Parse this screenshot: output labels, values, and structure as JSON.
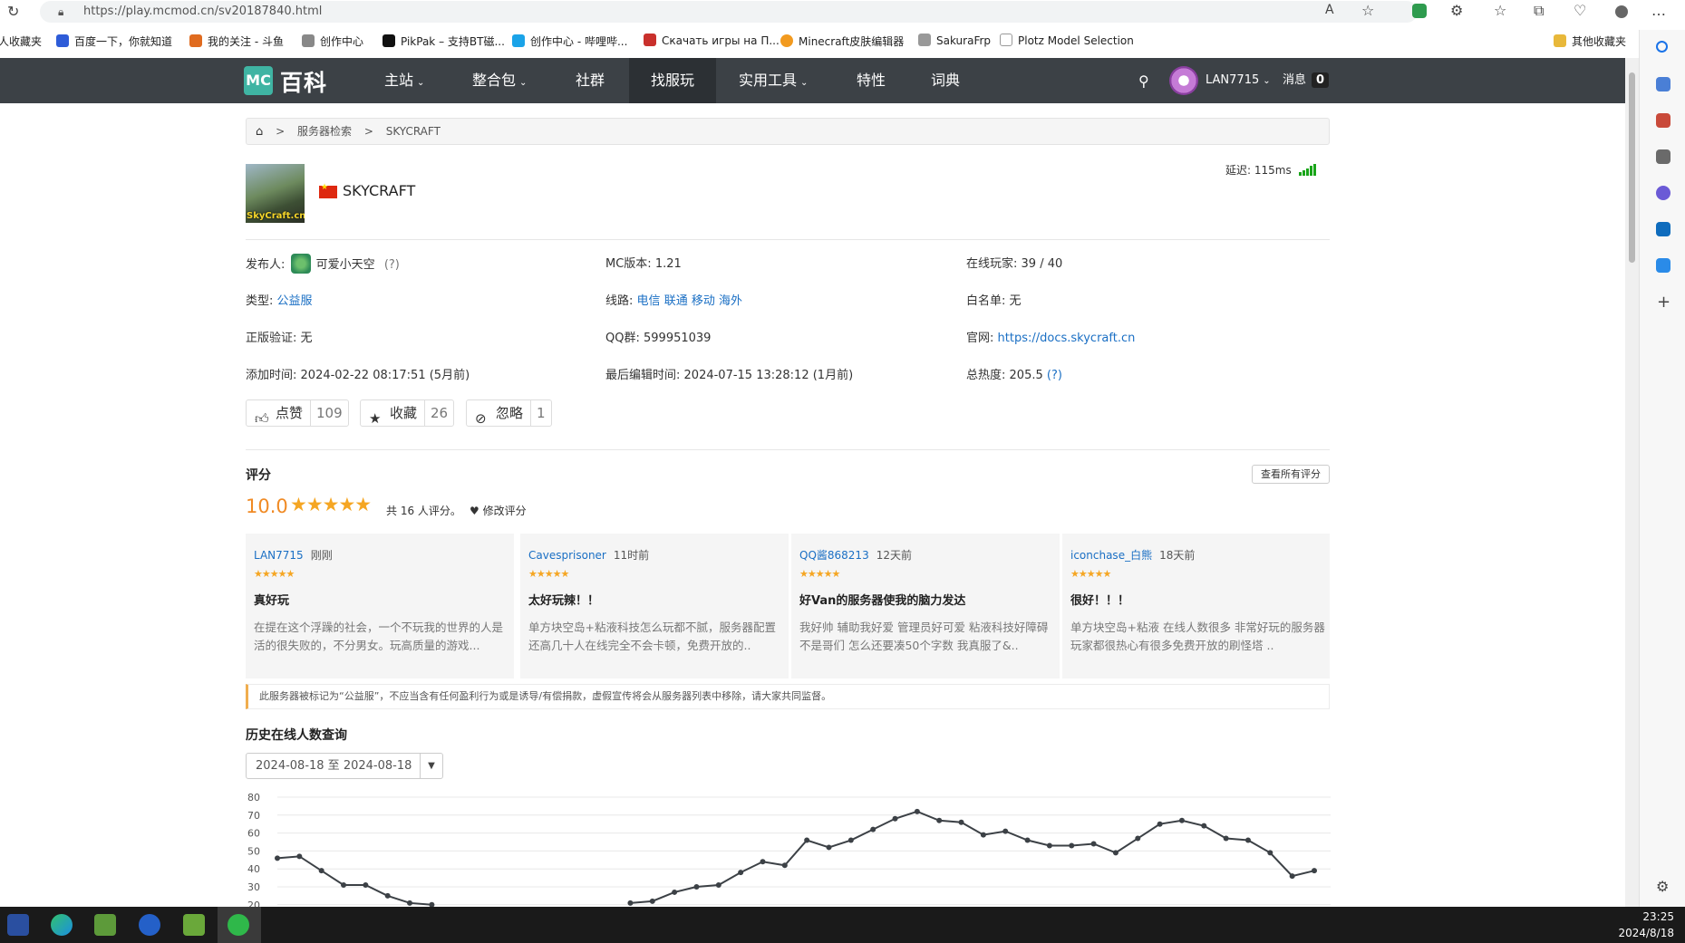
{
  "browser": {
    "url": "https://play.mcmod.cn/sv20187840.html",
    "bookmarks": [
      {
        "label": "人收藏夹",
        "icon": "folder-icon"
      },
      {
        "label": "百度一下，你就知道",
        "icon": "baidu-icon"
      },
      {
        "label": "我的关注 - 斗鱼",
        "icon": "douyu-icon"
      },
      {
        "label": "创作中心",
        "icon": "creator-icon"
      },
      {
        "label": "PikPak – 支持BT磁...",
        "icon": "pikpak-icon"
      },
      {
        "label": "创作中心 - 哔哩哔...",
        "icon": "bilibili-icon"
      },
      {
        "label": "Скачать игры на П...",
        "icon": "game-icon"
      },
      {
        "label": "Minecraft皮肤编辑器",
        "icon": "skin-editor-icon"
      },
      {
        "label": "SakuraFrp",
        "icon": "sakura-icon"
      },
      {
        "label": "Plotz Model Selection",
        "icon": "plotz-icon"
      },
      {
        "label": "其他收藏夹",
        "icon": "folder-icon"
      }
    ]
  },
  "nav": {
    "logo_mc": "MC",
    "logo_text": "百科",
    "items": [
      {
        "label": "主站",
        "dropdown": true
      },
      {
        "label": "整合包",
        "dropdown": true
      },
      {
        "label": "社群",
        "dropdown": false
      },
      {
        "label": "找服玩",
        "dropdown": false,
        "active": true
      },
      {
        "label": "实用工具",
        "dropdown": true
      },
      {
        "label": "特性",
        "dropdown": false
      },
      {
        "label": "词典",
        "dropdown": false
      }
    ],
    "user": "LAN7715",
    "msg_label": "消息",
    "msg_count": "0"
  },
  "breadcrumb": [
    "服务器检索",
    "SKYCRAFT"
  ],
  "server": {
    "thumb_label": "SkyCraft.cn",
    "name": "SKYCRAFT",
    "latency": "延迟: 115ms",
    "info": {
      "publisher_label": "发布人:",
      "publisher": "可爱小天空",
      "publisher_q": "(?)",
      "mc_version_label": "MC版本:",
      "mc_version": "1.21",
      "online_label": "在线玩家:",
      "online": "39 / 40",
      "type_label": "类型:",
      "type": "公益服",
      "line_label": "线路:",
      "lines": [
        "电信",
        "联通",
        "移动",
        "海外"
      ],
      "whitelist_label": "白名单:",
      "whitelist": "无",
      "genuine_label": "正版验证:",
      "genuine": "无",
      "qq_label": "QQ群:",
      "qq": "599951039",
      "site_label": "官网:",
      "site": "https://docs.skycraft.cn",
      "added_label": "添加时间:",
      "added": "2024-02-22 08:17:51 (5月前)",
      "edited_label": "最后编辑时间:",
      "edited": "2024-07-15 13:28:12 (1月前)",
      "heat_label": "总热度:",
      "heat": "205.5",
      "heat_q": "(?)"
    },
    "actions": [
      {
        "label": "点赞",
        "count": "109",
        "icon": "thumbs-up-icon"
      },
      {
        "label": "收藏",
        "count": "26",
        "icon": "star-icon"
      },
      {
        "label": "忽略",
        "count": "1",
        "icon": "eye-slash-icon"
      }
    ]
  },
  "rating": {
    "title": "评分",
    "view_all": "查看所有评分",
    "score": "10.0",
    "stars": 5,
    "count_text": "共 16 人评分。",
    "edit_label": "修改评分",
    "reviews": [
      {
        "user": "LAN7715",
        "time": "刚刚",
        "stars": 5,
        "title": "真好玩",
        "body": "在提在这个浮躁的社会，一个不玩我的世界的人是活的很失败的，不分男女。玩高质量的游戏..."
      },
      {
        "user": "Cavesprisoner",
        "time": "11时前",
        "stars": 5,
        "title": "太好玩辣！！",
        "body": "单方块空岛+粘液科技怎么玩都不腻，服务器配置还高几十人在线完全不会卡顿，免费开放的.."
      },
      {
        "user": "QQ酱868213",
        "time": "12天前",
        "stars": 5,
        "title": "好Van的服务器使我的脑力发达",
        "body": "我好帅 辅助我好爱 管理员好可爱 粘液科技好障碍不是哥们 怎么还要凑50个字数 我真服了&.."
      },
      {
        "user": "iconchase_白熊",
        "time": "18天前",
        "stars": 5,
        "title": "很好！！！",
        "body": "单方块空岛+粘液 在线人数很多 非常好玩的服务器 玩家都很热心有很多免费开放的刷怪塔 .."
      }
    ]
  },
  "notice": "此服务器被标记为“公益服”，不应当含有任何盈利行为或是诱导/有偿捐款，虚假宣传将会从服务器列表中移除，请大家共同监督。",
  "history": {
    "title": "历史在线人数查询",
    "date_range": "2024-08-18 至 2024-08-18"
  },
  "chart_data": {
    "type": "line",
    "title": "",
    "xlabel": "",
    "ylabel": "",
    "ylim": [
      0,
      80
    ],
    "yticks": [
      80,
      70,
      60,
      50,
      40,
      30,
      20
    ],
    "series": [
      {
        "values": [
          46,
          47,
          39,
          31,
          31,
          25,
          21,
          20,
          null,
          null,
          null,
          null,
          null,
          null,
          null,
          null,
          21,
          22,
          27,
          30,
          31,
          38,
          44,
          42,
          56,
          52,
          56,
          62,
          68,
          72,
          67,
          66,
          59,
          61,
          56,
          53,
          53,
          54,
          49,
          57,
          65,
          67,
          64,
          57,
          56,
          49,
          36,
          39
        ]
      }
    ],
    "color": "#3c4146",
    "grid": true
  },
  "taskbar": {
    "apps": [
      "mcmod-icon",
      "edge-icon",
      "minecraft-icon",
      "p-app-icon",
      "minecraft-launcher-icon",
      "wechat-icon"
    ],
    "time": "23:25",
    "date": "2024/8/18"
  }
}
